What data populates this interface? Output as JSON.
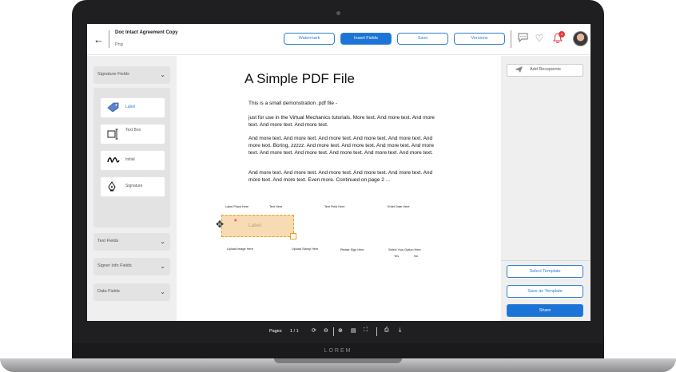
{
  "brand": "LOREM",
  "header": {
    "back_icon": "arrow-left-icon",
    "doc_title": "Doc Intact Agreement Copy",
    "doc_subtitle": "Png",
    "buttons": {
      "watermark": "Watermark",
      "insert_fields": "Insert Fields",
      "save": "Save",
      "versions": "Versions"
    },
    "notification_count": "4",
    "accent": "#1b74d6"
  },
  "left_sidebar": {
    "signature_fields": "Signature Fields",
    "signature_items": [
      {
        "label": "Label",
        "icon": "tag-icon"
      },
      {
        "label": "Text Box",
        "icon": "text-cursor-icon"
      },
      {
        "label": "Initial",
        "icon": "scribble-icon"
      },
      {
        "label": "Signature",
        "icon": "pen-nib-icon"
      }
    ],
    "text_fields": "Text Fields",
    "signer_info_fields": "Signer Info Fields",
    "data_fields": "Data Fields"
  },
  "document": {
    "title": "A Simple PDF File",
    "p1": "This is a small demonstration .pdf file -",
    "p2": "just for use in the Virtual Mechanics tutorials. More text. And more text. And more text. And more text. And more text.",
    "p3": "And more text. And more text. And more text. And more text. And more text. And more text. Boring, zzzzz. And more text. And more text. And more text. And more text. And more text. And more text. And more text. And more text. And more text.",
    "p4": "And more text. And more text. And more text. And more text. And more text. And more text. And more text. Even more. Continued on page 2 ...",
    "placed_fields": {
      "label_place": "Label Place Here",
      "text_here": "Text Here",
      "text_field": "Text Field Here",
      "enter_date": "Enter Date Here",
      "upload_image": "Upload Image Here",
      "upload_stamp": "Upload Stamp Here",
      "please_sign": "Please Sign Here",
      "select_option": "Select Your Option Here",
      "yes": "Yes",
      "no": "No"
    },
    "selected_field_label": "Label",
    "selected_field_close": "×"
  },
  "right_sidebar": {
    "add_recipients": "Add Recepients",
    "select_template": "Select Template",
    "save_as_template": "Save as Template",
    "share": "Share"
  },
  "toolbar": {
    "pages_label": "Pages",
    "page_indicator": "1 / 1"
  }
}
